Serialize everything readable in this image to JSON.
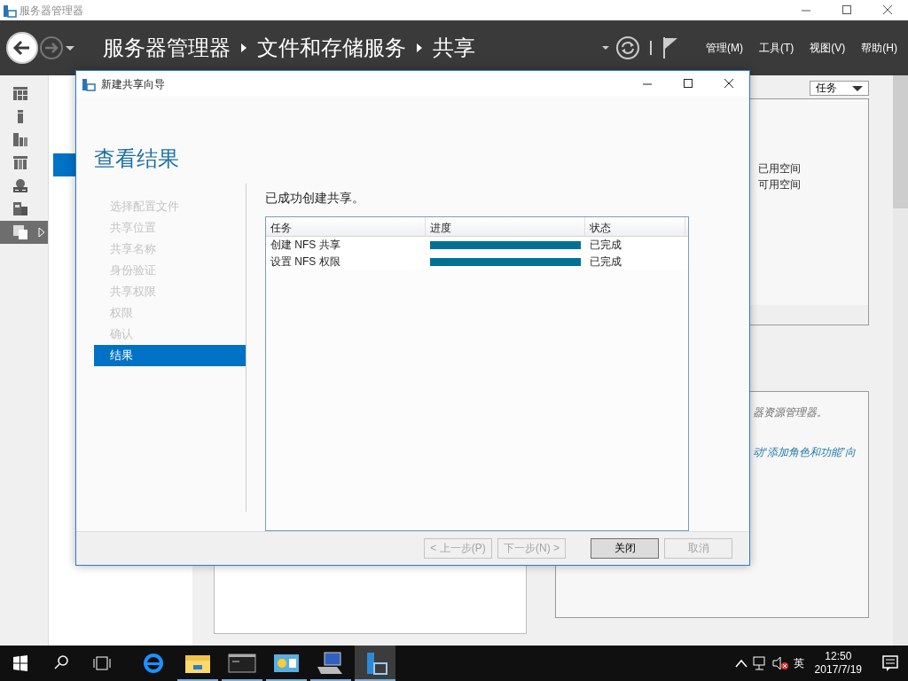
{
  "window": {
    "title": "服务器管理器"
  },
  "header": {
    "breadcrumb": [
      "服务器管理器",
      "文件和存储服务",
      "共享"
    ],
    "menu": [
      "管理(M)",
      "工具(T)",
      "视图(V)",
      "帮助(H)"
    ]
  },
  "sidebar": {
    "items": [
      {
        "kind": "dashboard",
        "selected": false
      },
      {
        "kind": "server",
        "selected": false
      },
      {
        "kind": "servers",
        "selected": false
      },
      {
        "kind": "group",
        "selected": false
      },
      {
        "kind": "network",
        "selected": false
      },
      {
        "kind": "building",
        "selected": false
      },
      {
        "kind": "files",
        "selected": true
      }
    ]
  },
  "tasks_button": "任务",
  "storage_panel": {
    "lines": [
      "已用空间",
      "可用空间"
    ]
  },
  "info_panel": {
    "text": "器资源管理器。",
    "link": "动“添加角色和功能”向"
  },
  "dialog": {
    "title": "新建共享向导",
    "heading": "查看结果",
    "steps": [
      {
        "label": "选择配置文件",
        "selected": false
      },
      {
        "label": "共享位置",
        "selected": false
      },
      {
        "label": "共享名称",
        "selected": false
      },
      {
        "label": "身份验证",
        "selected": false
      },
      {
        "label": "共享权限",
        "selected": false
      },
      {
        "label": "权限",
        "selected": false
      },
      {
        "label": "确认",
        "selected": false
      },
      {
        "label": "结果",
        "selected": true
      }
    ],
    "message": "已成功创建共享。",
    "table": {
      "columns": [
        "任务",
        "进度",
        "状态"
      ],
      "rows": [
        {
          "task": "创建 NFS 共享",
          "level": 1,
          "status": "已完成"
        },
        {
          "task": "设置 NFS 权限",
          "level": 1,
          "status": "已完成"
        }
      ]
    },
    "buttons": [
      {
        "label": "< 上一步(P)",
        "disabled": true,
        "default": false
      },
      {
        "label": "下一步(N) >",
        "disabled": true,
        "default": false
      },
      {
        "label": "关闭",
        "disabled": false,
        "default": true
      },
      {
        "label": "取消",
        "disabled": true,
        "default": false
      }
    ]
  },
  "taskbar": {
    "apps": [
      {
        "kind": "browser",
        "running": false,
        "active": false
      },
      {
        "kind": "folder",
        "running": true,
        "active": false
      },
      {
        "kind": "terminal",
        "running": true,
        "active": false
      },
      {
        "kind": "panel",
        "running": true,
        "active": false
      },
      {
        "kind": "computer",
        "running": true,
        "active": false
      },
      {
        "kind": "manager",
        "running": true,
        "active": true
      }
    ],
    "language": "英",
    "time": "12:50",
    "date": "2017/7/19"
  }
}
